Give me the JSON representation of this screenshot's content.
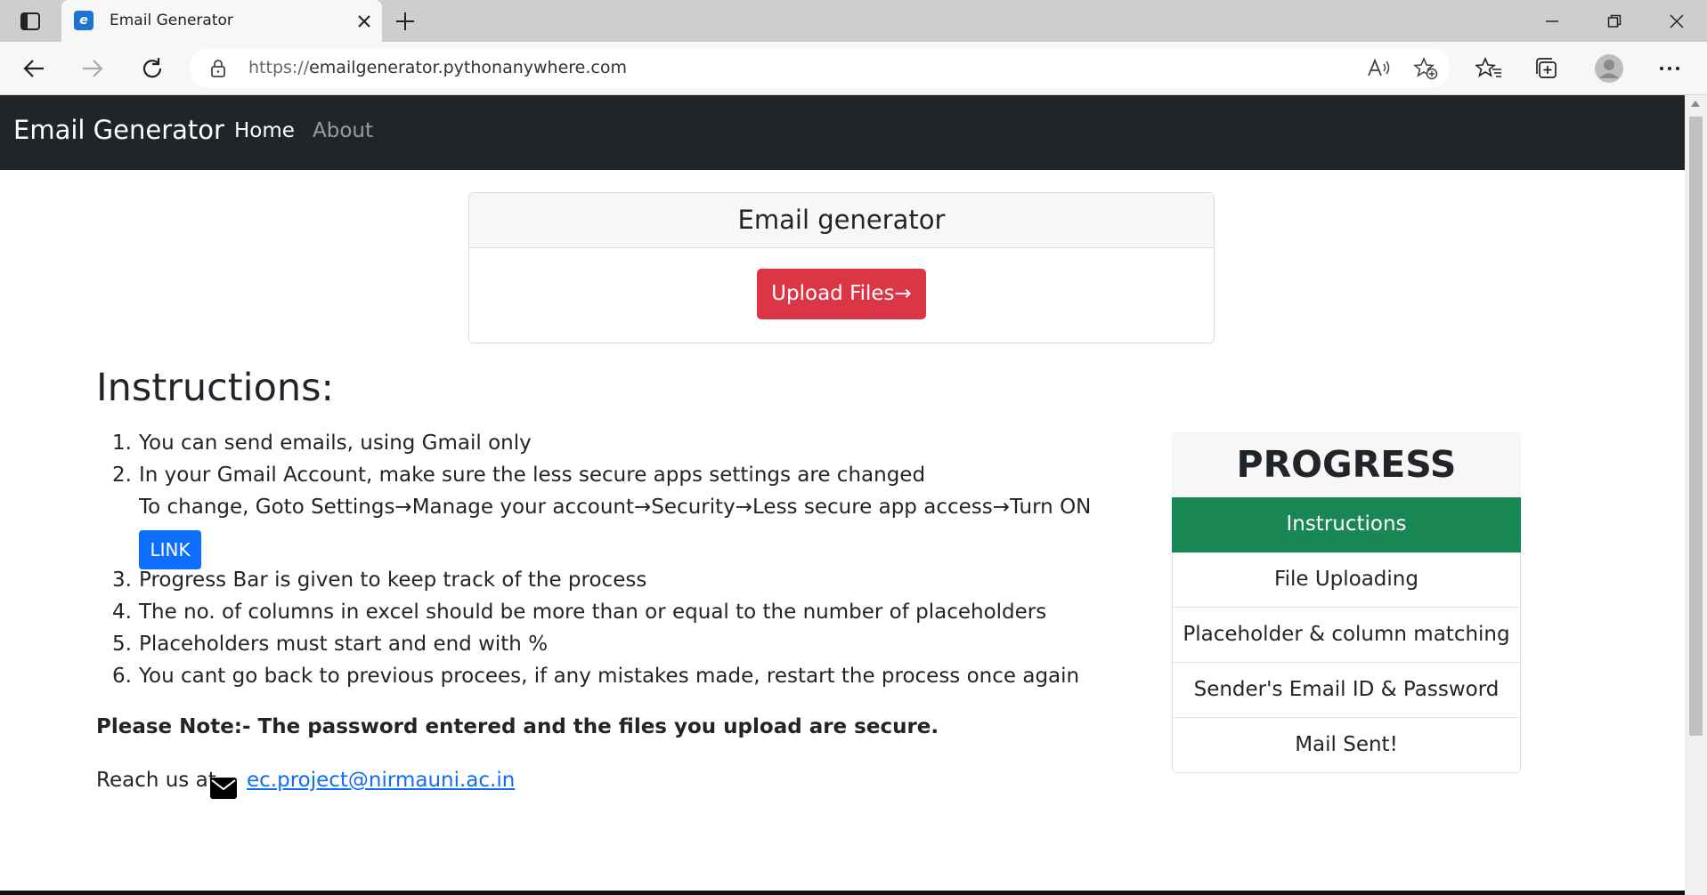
{
  "browser": {
    "tab_title": "Email Generator",
    "url_protocol": "https://",
    "url_host": "emailgenerator.pythonanywhere.com",
    "favicon_letter": "e"
  },
  "navbar": {
    "brand": "Email Generator",
    "links": [
      "Home",
      "About"
    ]
  },
  "card": {
    "title": "Email generator",
    "button": "Upload Files→"
  },
  "instructions": {
    "title": "Instructions:",
    "items": [
      {
        "num": "1.",
        "text": "You can send emails, using Gmail only"
      },
      {
        "num": "2.",
        "text": "In your Gmail Account, make sure the less secure apps settings are changed"
      },
      {
        "num": "3.",
        "text": "Progress Bar is given to keep track of the process"
      },
      {
        "num": "4.",
        "text": "The no. of columns in excel should be more than or equal to the number of placeholders"
      },
      {
        "num": "5.",
        "text": "Placeholders must start and end with %"
      },
      {
        "num": "6.",
        "text": "You cant go back to previous procees, if any mistakes made, restart the process once again"
      }
    ],
    "sub_text": "To change, Goto Settings→Manage your account→Security→Less secure app access→Turn ON",
    "link_label": "LINK"
  },
  "note": "Please Note:- The password entered and the files you upload are secure.",
  "contact": {
    "prefix": "Reach us at",
    "email": "ec.project@nirmauni.ac.in"
  },
  "progress": {
    "title": "PROGRESS",
    "steps": [
      {
        "label": "Instructions",
        "active": true
      },
      {
        "label": "File Uploading",
        "active": false
      },
      {
        "label": "Placeholder & column matching",
        "active": false
      },
      {
        "label": "Sender's Email ID & Password",
        "active": false
      },
      {
        "label": "Mail Sent!",
        "active": false
      }
    ]
  },
  "colors": {
    "navbar_bg": "#212529",
    "upload_button": "#dc3545",
    "link_button": "#0d6efd",
    "active_step": "#198754"
  }
}
